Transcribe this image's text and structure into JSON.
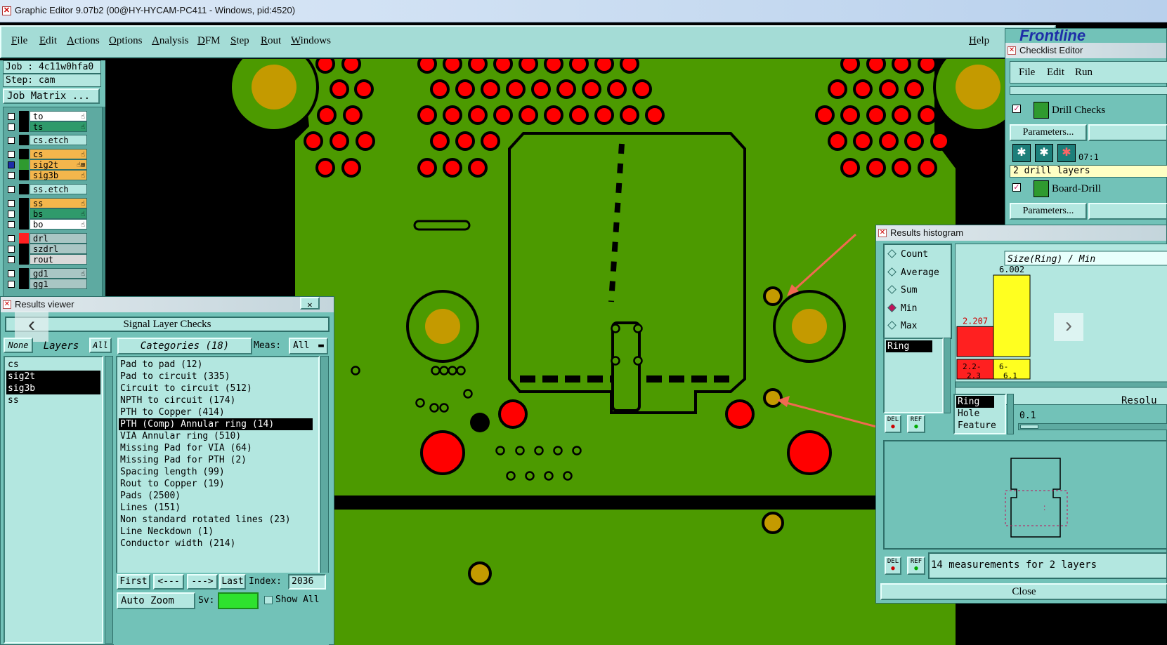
{
  "window": {
    "title": "Graphic Editor 9.07b2 (00@HY-HYCAM-PC411 - Windows, pid:4520)"
  },
  "menu": {
    "items": [
      "File",
      "Edit",
      "Actions",
      "Options",
      "Analysis",
      "DFM",
      "Step",
      "Rout",
      "Windows"
    ],
    "help": "Help"
  },
  "job": {
    "job_label": "Job : 4c11w0hfa0",
    "step_label": "Step: cam",
    "matrix_button": "Job Matrix ..."
  },
  "layers": [
    {
      "name": "to",
      "color": "#ffffff",
      "swatch": "#000000",
      "icon": "☝"
    },
    {
      "name": "ts",
      "color": "#2f9a6b",
      "swatch": "#000000",
      "icon": "☝"
    },
    {
      "name": "cs.etch",
      "color": "#b3e7e0",
      "swatch": "#000000",
      "icon": ""
    },
    {
      "name": "cs",
      "color": "#f4b64c",
      "swatch": "#000000",
      "icon": "☝"
    },
    {
      "name": "sig2t",
      "color": "#f4b64c",
      "swatch": "#2f9a2f",
      "icon": "☝⊞"
    },
    {
      "name": "sig3b",
      "color": "#f4b64c",
      "swatch": "#000000",
      "icon": "☝"
    },
    {
      "name": "ss.etch",
      "color": "#b3e7e0",
      "swatch": "#000000",
      "icon": ""
    },
    {
      "name": "ss",
      "color": "#f4b64c",
      "swatch": "#000000",
      "icon": "☝"
    },
    {
      "name": "bs",
      "color": "#2f9a6b",
      "swatch": "#000000",
      "icon": "☝"
    },
    {
      "name": "bo",
      "color": "#ffffff",
      "swatch": "#000000",
      "icon": "☝"
    },
    {
      "name": "drl",
      "color": "#a9c6c4",
      "swatch": "#ff2020",
      "icon": ""
    },
    {
      "name": "szdrl",
      "color": "#a9c6c4",
      "swatch": "#000000",
      "icon": ""
    },
    {
      "name": "rout",
      "color": "#d9d9d9",
      "swatch": "#000000",
      "icon": ""
    },
    {
      "name": "gd1",
      "color": "#a9c6c4",
      "swatch": "#000000",
      "icon": "☝"
    },
    {
      "name": "gg1",
      "color": "#a9c6c4",
      "swatch": "#000000",
      "icon": ""
    }
  ],
  "results_viewer": {
    "title": "Results viewer",
    "close_glyph": "✕",
    "header": "Signal Layer Checks",
    "none_btn": "None",
    "layers_label": "Layers",
    "all_btn": "All",
    "layer_list": [
      "cs",
      "sig2t",
      "sig3b",
      "ss"
    ],
    "categories_label": "Categories (18)",
    "meas_label": "Meas:",
    "meas_value": "All",
    "categories": [
      "Pad to pad (12)",
      "Pad to circuit (335)",
      "Circuit to circuit (512)",
      "NPTH to circuit (174)",
      "PTH to Copper (414)",
      "PTH (Comp) Annular ring (14)",
      "VIA Annular ring (510)",
      "Missing Pad for VIA (64)",
      "Missing Pad for PTH (2)",
      "Spacing length (99)",
      "Rout to Copper (19)",
      "Pads (2500)",
      "Lines (151)",
      "Non standard rotated lines (23)",
      "Line Neckdown (1)",
      "Conductor width (214)"
    ],
    "selected_index": 5,
    "first_btn": "First",
    "prev_btn": "<---",
    "next_btn": "--->",
    "last_btn": "Last",
    "index_label": "Index:",
    "index_value": "2036",
    "auto_zoom": "Auto Zoom",
    "sv_label": "Sv:",
    "show_all": "Show All"
  },
  "checklist_editor": {
    "title": "Checklist Editor",
    "brand": "Frontline",
    "menu": [
      "File",
      "Edit",
      "Run"
    ],
    "check1_label": "Drill Checks",
    "params_btn": "Parameters...",
    "time_text": "07:1",
    "drill_info": "2 drill layers",
    "check2_label": "Board-Drill"
  },
  "histogram": {
    "title": "Results histogram",
    "modes": [
      "Count",
      "Average",
      "Sum",
      "Min",
      "Max"
    ],
    "selected_mode": "Min",
    "field_value": "Ring",
    "del_btn": "DEL",
    "ref_btn": "REF",
    "chart_title": "Size(Ring) / Min",
    "resolution_label": "Resolu",
    "resolution_value": "0.1",
    "attr_list": [
      "Ring",
      "Hole",
      "Feature"
    ],
    "status_text": "14 measurements for 2 layers",
    "close_btn": "Close"
  },
  "chart_data": {
    "type": "bar",
    "title": "Size(Ring) / Min",
    "categories": [
      "2.2-\n2.3",
      "6-\n6.1"
    ],
    "category_labels": [
      [
        "2.2-",
        "2.3"
      ],
      [
        "6-",
        "6.1"
      ]
    ],
    "values": [
      2.207,
      6.002
    ],
    "value_labels": [
      "2.207",
      "6.002"
    ],
    "colors": [
      "#ff2020",
      "#ffff20"
    ]
  },
  "colors": {
    "panel": "#72c2b8",
    "panel_light": "#b3e7e0",
    "board_green": "#4c9a00",
    "pad_red": "#ff0000",
    "gold": "#c49a00",
    "arrow": "#f06a50"
  }
}
